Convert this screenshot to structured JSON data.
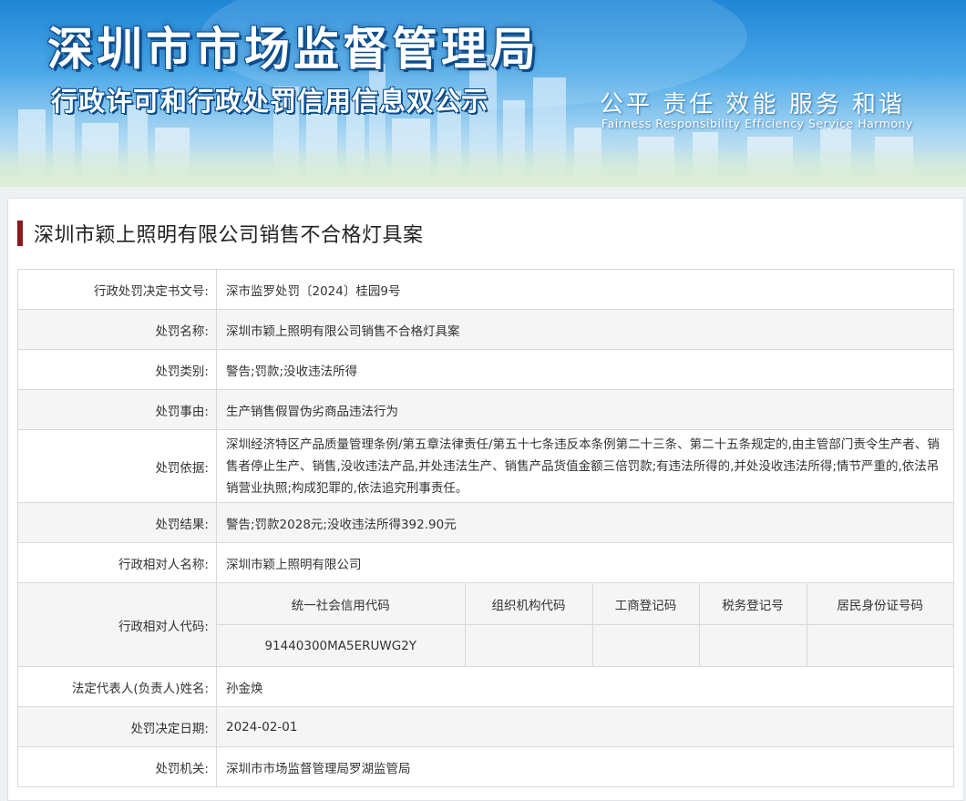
{
  "banner": {
    "title": "深圳市市场监督管理局",
    "subtitle": "行政许可和行政处罚信用信息双公示",
    "slogan": "公平 责任 效能 服务 和谐",
    "slogan_en": "Fairness Responsibility Efficiency Service Harmony"
  },
  "case": {
    "title": "深圳市颖上照明有限公司销售不合格灯具案"
  },
  "fields": [
    {
      "label": "行政处罚决定书文号:",
      "value": "深市监罗处罚〔2024〕桂园9号"
    },
    {
      "label": "处罚名称:",
      "value": "深圳市颖上照明有限公司销售不合格灯具案"
    },
    {
      "label": "处罚类别:",
      "value": "警告;罚款;没收违法所得"
    },
    {
      "label": "处罚事由:",
      "value": "生产销售假冒伪劣商品违法行为"
    },
    {
      "label": "处罚依据:",
      "value": "深圳经济特区产品质量管理条例/第五章法律责任/第五十七条违反本条例第二十三条、第二十五条规定的,由主管部门责令生产者、销售者停止生产、销售,没收违法产品,并处违法生产、销售产品货值金额三倍罚款;有违法所得的,并处没收违法所得;情节严重的,依法吊销营业执照;构成犯罪的,依法追究刑事责任。"
    },
    {
      "label": "处罚结果:",
      "value": "警告;罚款2028元;没收违法所得392.90元"
    },
    {
      "label": "行政相对人名称:",
      "value": "深圳市颖上照明有限公司"
    }
  ],
  "codes": {
    "label": "行政相对人代码:",
    "headers": [
      "统一社会信用代码",
      "组织机构代码",
      "工商登记码",
      "税务登记号",
      "居民身份证号码"
    ],
    "values": [
      "91440300MA5ERUWG2Y",
      "",
      "",
      "",
      ""
    ]
  },
  "fields_after": [
    {
      "label": "法定代表人(负责人)姓名:",
      "value": "孙金焕"
    },
    {
      "label": "处罚决定日期:",
      "value": "2024-02-01"
    },
    {
      "label": "处罚机关:",
      "value": "深圳市市场监督管理局罗湖监管局"
    }
  ],
  "colors": {
    "heading_bar": "#8b1a1a",
    "banner_blue": "#1f86d6",
    "row_alt": "#f5f5f5",
    "border": "#d9d9d9"
  }
}
